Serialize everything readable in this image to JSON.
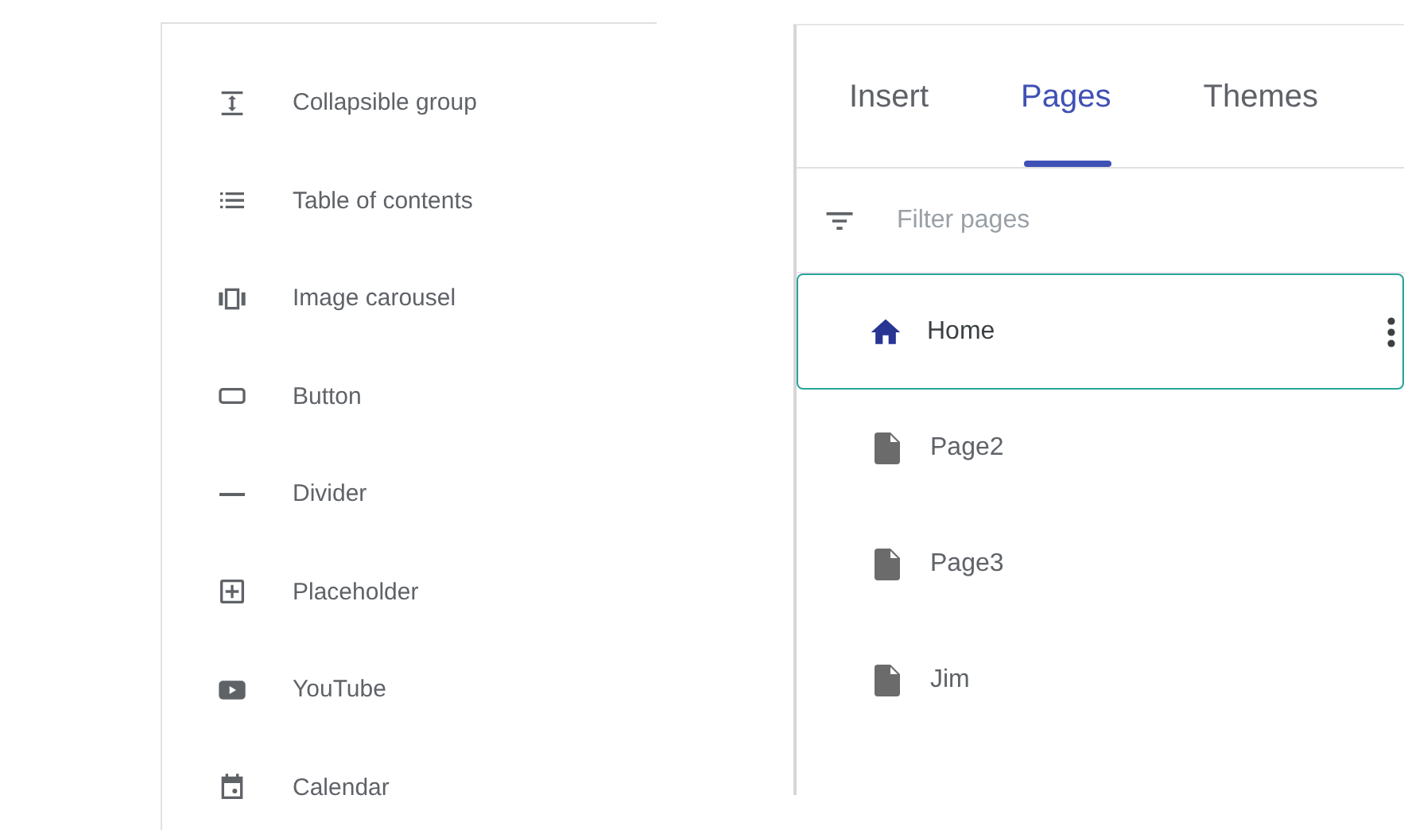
{
  "insert_panel": {
    "items": [
      {
        "label": "Collapsible group"
      },
      {
        "label": "Table of contents"
      },
      {
        "label": "Image carousel"
      },
      {
        "label": "Button"
      },
      {
        "label": "Divider"
      },
      {
        "label": "Placeholder"
      },
      {
        "label": "YouTube"
      },
      {
        "label": "Calendar"
      }
    ]
  },
  "pages_panel": {
    "tabs": [
      {
        "label": "Insert",
        "selected": false
      },
      {
        "label": "Pages",
        "selected": true
      },
      {
        "label": "Themes",
        "selected": false
      }
    ],
    "filter": {
      "placeholder": "Filter pages"
    },
    "pages": [
      {
        "label": "Home",
        "kind": "home",
        "selected": true
      },
      {
        "label": "Page2",
        "kind": "page",
        "selected": false
      },
      {
        "label": "Page3",
        "kind": "page",
        "selected": false
      },
      {
        "label": "Jim",
        "kind": "page",
        "selected": false
      }
    ]
  }
}
